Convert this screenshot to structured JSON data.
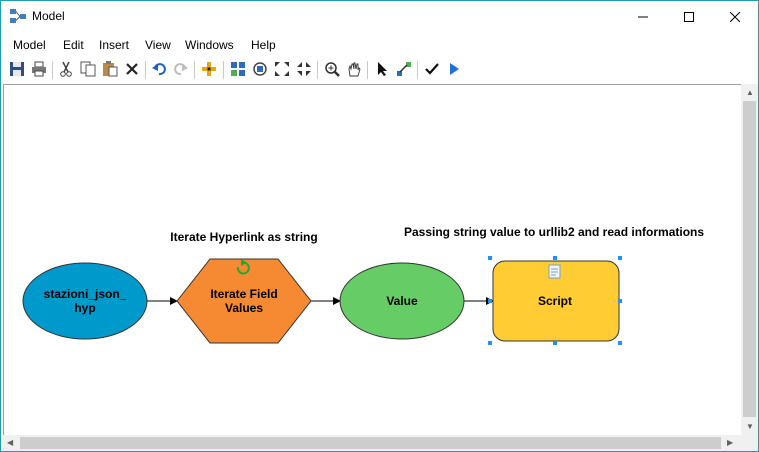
{
  "window": {
    "title": "Model"
  },
  "menu": [
    "Model",
    "Edit",
    "Insert",
    "View",
    "Windows",
    "Help"
  ],
  "toolbar_icons": [
    "save-icon",
    "print-icon",
    "cut-icon",
    "copy-icon",
    "paste-icon",
    "delete-icon",
    "undo-icon",
    "redo-icon",
    "add-data-icon",
    "auto-layout-icon",
    "full-extent-icon",
    "fixed-zoom-in-icon",
    "fixed-zoom-out-icon",
    "zoom-in-icon",
    "pan-icon",
    "select-icon",
    "connect-icon",
    "validate-icon",
    "run-icon"
  ],
  "diagram": {
    "labels": {
      "iterate_caption": "Iterate Hyperlink as string",
      "script_caption": "Passing string value to urllib2 and read informations"
    },
    "nodes": {
      "input": {
        "label_line1": "stazioni_json_",
        "label_line2": "hyp",
        "color": "#0099cc"
      },
      "iterator": {
        "label_line1": "Iterate Field",
        "label_line2": "Values",
        "color": "#f58a33"
      },
      "value": {
        "label": "Value",
        "color": "#66cc66"
      },
      "script": {
        "label": "Script",
        "color": "#ffcc33"
      }
    }
  },
  "colors": {
    "window_border": "#1a9fb0",
    "selection_handle": "#1e90ff"
  }
}
